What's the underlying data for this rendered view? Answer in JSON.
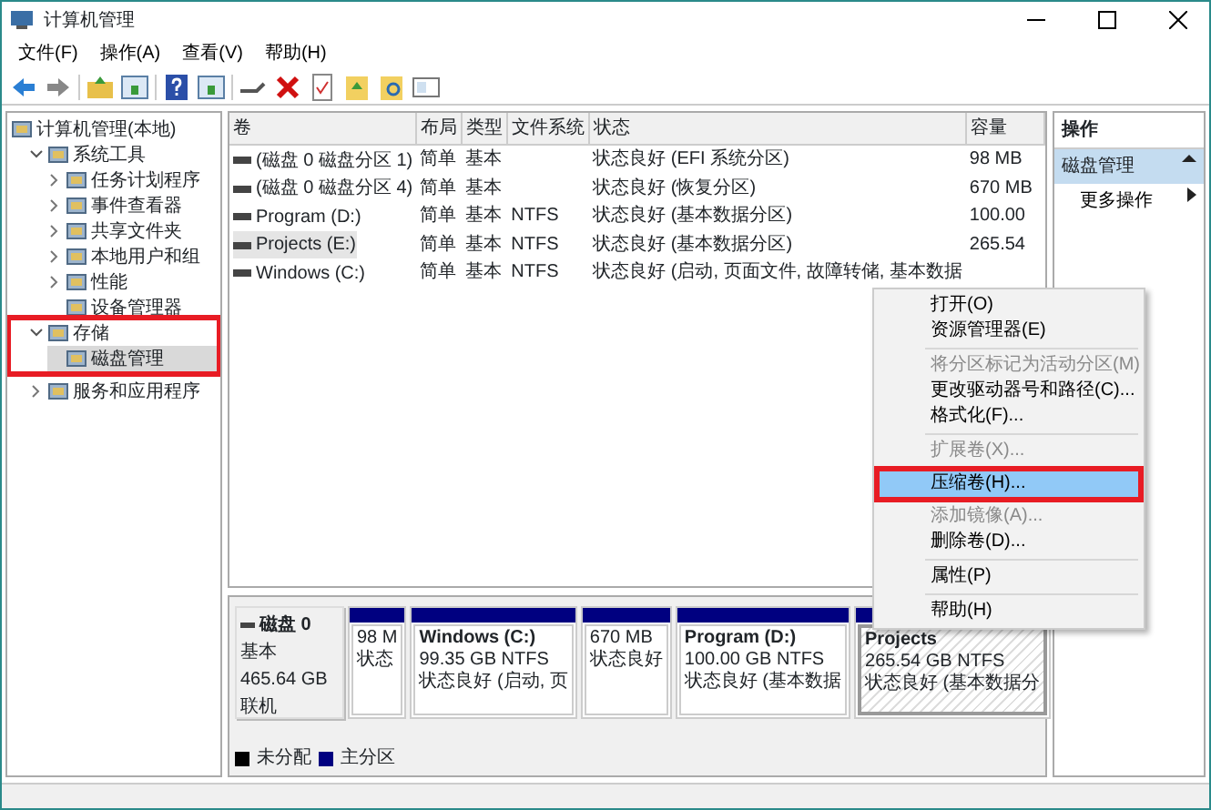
{
  "window": {
    "title": "计算机管理"
  },
  "menu_bar": [
    "文件(F)",
    "操作(A)",
    "查看(V)",
    "帮助(H)"
  ],
  "tree": [
    {
      "label": "计算机管理(本地)",
      "selected": false,
      "highlighted": false,
      "children": [
        {
          "label": "系统工具",
          "expanded": true,
          "selected": false,
          "highlighted": false,
          "children": [
            {
              "label": "任务计划程序",
              "expanded": false,
              "selected": false,
              "highlighted": false
            },
            {
              "label": "事件查看器",
              "expanded": false,
              "selected": false,
              "highlighted": false
            },
            {
              "label": "共享文件夹",
              "expanded": false,
              "selected": false,
              "highlighted": false
            },
            {
              "label": "本地用户和组",
              "expanded": false,
              "selected": false,
              "highlighted": false
            },
            {
              "label": "性能",
              "expanded": false,
              "selected": false,
              "highlighted": false
            },
            {
              "label": "设备管理器",
              "selected": false,
              "highlighted": false
            }
          ]
        },
        {
          "label": "存储",
          "expanded": true,
          "selected": false,
          "highlighted": true,
          "children": [
            {
              "label": "磁盘管理",
              "selected": true,
              "highlighted": false
            }
          ]
        },
        {
          "label": "服务和应用程序",
          "expanded": false,
          "selected": false,
          "highlighted": false
        }
      ]
    }
  ],
  "volume_table": {
    "columns": [
      "卷",
      "布局",
      "类型",
      "文件系统",
      "状态",
      "容量"
    ],
    "rows": [
      {
        "cells": [
          "(磁盘 0 磁盘分区 1)",
          "简单",
          "基本",
          "",
          "状态良好 (EFI 系统分区)",
          "98 MB"
        ],
        "selected": false
      },
      {
        "cells": [
          "(磁盘 0 磁盘分区 4)",
          "简单",
          "基本",
          "",
          "状态良好 (恢复分区)",
          "670 MB"
        ],
        "selected": false
      },
      {
        "cells": [
          "Program (D:)",
          "简单",
          "基本",
          "NTFS",
          "状态良好 (基本数据分区)",
          "100.00"
        ],
        "selected": false
      },
      {
        "cells": [
          "Projects (E:)",
          "简单",
          "基本",
          "NTFS",
          "状态良好 (基本数据分区)",
          "265.54"
        ],
        "selected": true
      },
      {
        "cells": [
          "Windows (C:)",
          "简单",
          "基本",
          "NTFS",
          "状态良好 (启动, 页面文件, 故障转储, 基本数据",
          ""
        ],
        "selected": false
      }
    ]
  },
  "disk": {
    "name": "磁盘 0",
    "lines": [
      "基本",
      "465.64 GB",
      "联机"
    ],
    "partitions": [
      {
        "lines": [
          "98 M",
          "状态"
        ],
        "selected": false
      },
      {
        "name": "Windows  (C:)",
        "lines": [
          "99.35 GB NTFS",
          "状态良好 (启动, 页"
        ],
        "selected": false
      },
      {
        "lines": [
          "670 MB",
          "状态良好"
        ],
        "selected": false
      },
      {
        "name": "Program  (D:)",
        "lines": [
          "100.00 GB NTFS",
          "状态良好 (基本数据"
        ],
        "selected": false
      },
      {
        "name": "Projects",
        "lines": [
          "265.54 GB NTFS",
          "状态良好 (基本数据分"
        ],
        "selected": true
      }
    ]
  },
  "legend": [
    {
      "label": "未分配",
      "color": "#000000"
    },
    {
      "label": "主分区",
      "color": "#000080"
    }
  ],
  "context_menu": [
    {
      "kind": "item",
      "label": "打开(O)",
      "disabled": false,
      "selected": false
    },
    {
      "kind": "item",
      "label": "资源管理器(E)",
      "disabled": false,
      "selected": false
    },
    {
      "kind": "separator"
    },
    {
      "kind": "item",
      "label": "将分区标记为活动分区(M)",
      "disabled": true,
      "selected": false
    },
    {
      "kind": "item",
      "label": "更改驱动器号和路径(C)...",
      "disabled": false,
      "selected": false
    },
    {
      "kind": "item",
      "label": "格式化(F)...",
      "disabled": false,
      "selected": false
    },
    {
      "kind": "separator"
    },
    {
      "kind": "item",
      "label": "扩展卷(X)...",
      "disabled": true,
      "selected": false
    },
    {
      "kind": "item",
      "label": "压缩卷(H)...",
      "disabled": false,
      "selected": true
    },
    {
      "kind": "item",
      "label": "添加镜像(A)...",
      "disabled": true,
      "selected": false
    },
    {
      "kind": "item",
      "label": "删除卷(D)...",
      "disabled": false,
      "selected": false
    },
    {
      "kind": "separator"
    },
    {
      "kind": "item",
      "label": "属性(P)",
      "disabled": false,
      "selected": false
    },
    {
      "kind": "separator"
    },
    {
      "kind": "item",
      "label": "帮助(H)",
      "disabled": false,
      "selected": false
    }
  ],
  "actions_pane": {
    "title": "操作",
    "section": {
      "label": "磁盘管理",
      "expanded": true
    },
    "items": [
      {
        "label": "更多操作"
      }
    ]
  }
}
